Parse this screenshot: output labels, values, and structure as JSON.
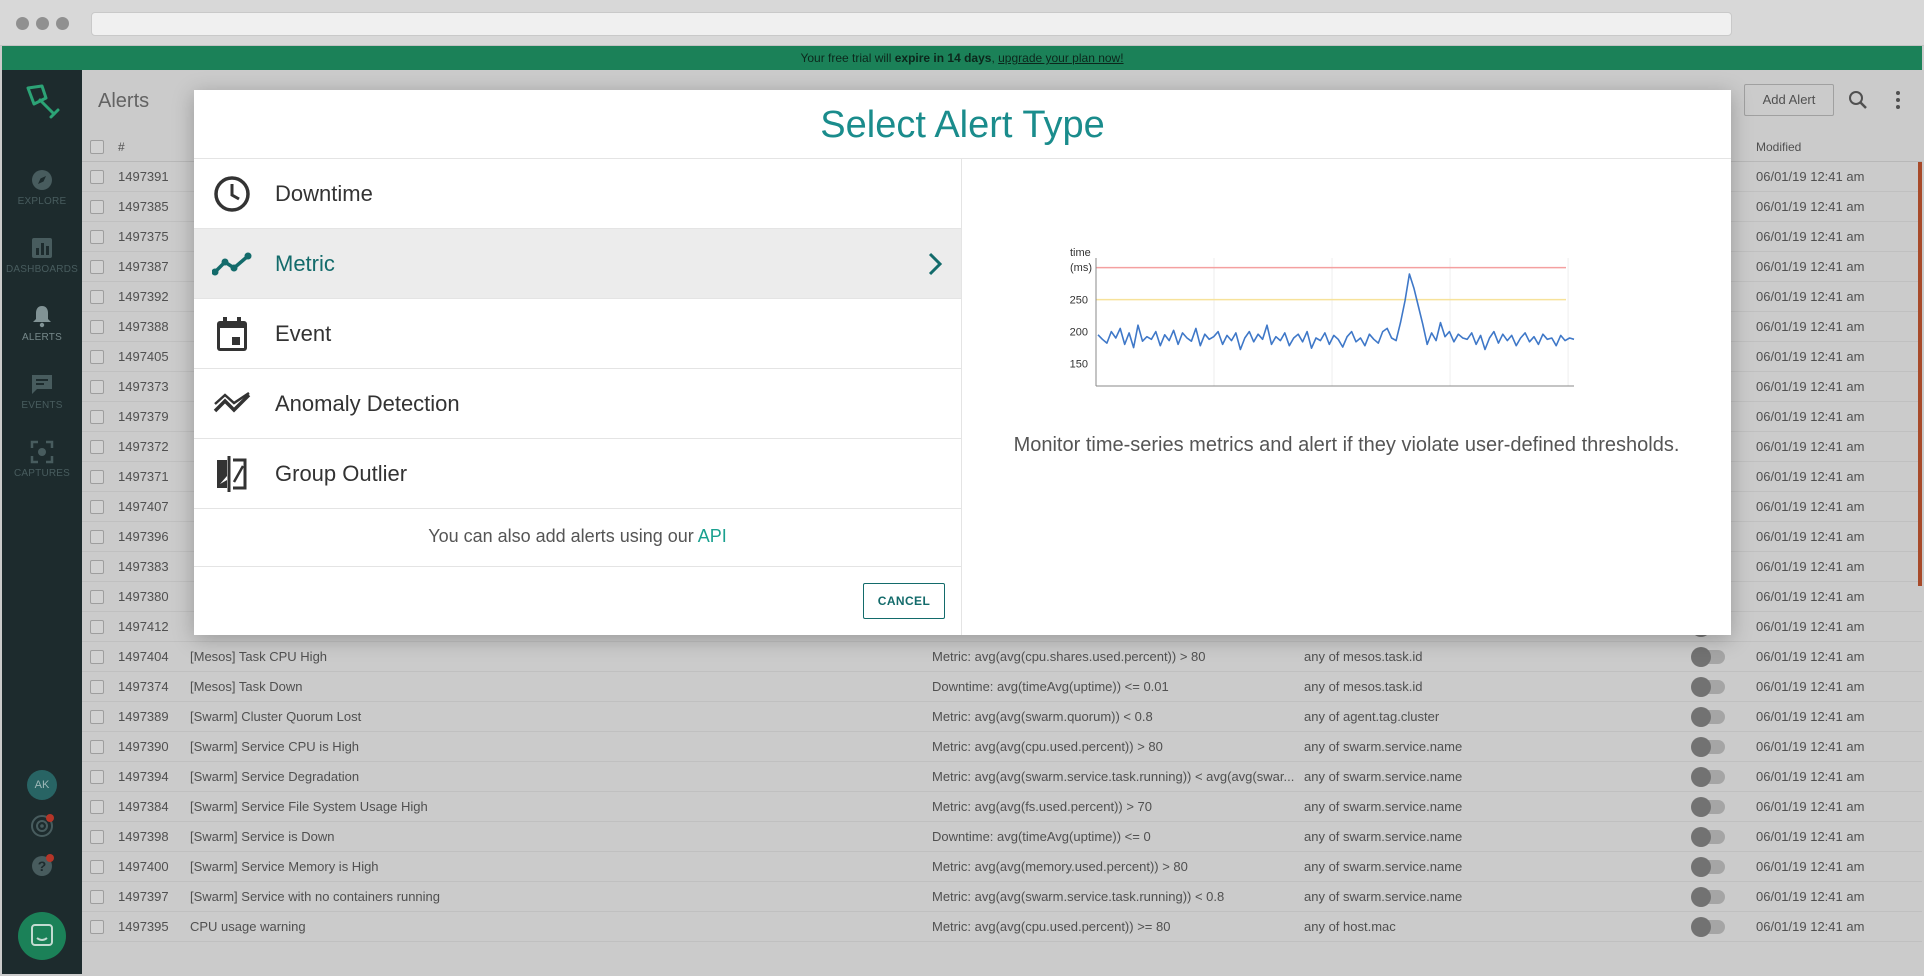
{
  "banner": {
    "prefix": "Your free trial will ",
    "bold": "expire in 14 days",
    "middle": ", ",
    "link": "upgrade your plan now!"
  },
  "sidebar": {
    "items": [
      {
        "label": "EXPLORE",
        "icon": "compass-icon"
      },
      {
        "label": "DASHBOARDS",
        "icon": "bar-chart-icon"
      },
      {
        "label": "ALERTS",
        "icon": "bell-icon"
      },
      {
        "label": "EVENTS",
        "icon": "message-icon"
      },
      {
        "label": "CAPTURES",
        "icon": "capture-icon"
      }
    ],
    "avatar_initials": "AK"
  },
  "page": {
    "title": "Alerts",
    "add_alert_label": "Add Alert"
  },
  "table": {
    "headers": {
      "id": "#",
      "modified": "Modified"
    },
    "rows": [
      {
        "id": "1497391",
        "name": "",
        "condition": "",
        "scope": "",
        "modified": "06/01/19 12:41 am"
      },
      {
        "id": "1497385",
        "name": "",
        "condition": "",
        "scope": "",
        "modified": "06/01/19 12:41 am"
      },
      {
        "id": "1497375",
        "name": "",
        "condition": "",
        "scope": "",
        "modified": "06/01/19 12:41 am"
      },
      {
        "id": "1497387",
        "name": "",
        "condition": "",
        "scope": "",
        "modified": "06/01/19 12:41 am"
      },
      {
        "id": "1497392",
        "name": "",
        "condition": "",
        "scope": "",
        "modified": "06/01/19 12:41 am"
      },
      {
        "id": "1497388",
        "name": "",
        "condition": "",
        "scope": "",
        "modified": "06/01/19 12:41 am"
      },
      {
        "id": "1497405",
        "name": "",
        "condition": "",
        "scope": "",
        "modified": "06/01/19 12:41 am"
      },
      {
        "id": "1497373",
        "name": "",
        "condition": "",
        "scope": "",
        "modified": "06/01/19 12:41 am"
      },
      {
        "id": "1497379",
        "name": "",
        "condition": "",
        "scope": "",
        "modified": "06/01/19 12:41 am"
      },
      {
        "id": "1497372",
        "name": "",
        "condition": "",
        "scope": "",
        "modified": "06/01/19 12:41 am"
      },
      {
        "id": "1497371",
        "name": "",
        "condition": "",
        "scope": "",
        "modified": "06/01/19 12:41 am"
      },
      {
        "id": "1497407",
        "name": "",
        "condition": "",
        "scope": "",
        "modified": "06/01/19 12:41 am"
      },
      {
        "id": "1497396",
        "name": "",
        "condition": "",
        "scope": "",
        "modified": "06/01/19 12:41 am"
      },
      {
        "id": "1497383",
        "name": "",
        "condition": "",
        "scope": "",
        "modified": "06/01/19 12:41 am"
      },
      {
        "id": "1497380",
        "name": "",
        "condition": "",
        "scope": "",
        "modified": "06/01/19 12:41 am"
      },
      {
        "id": "1497412",
        "name": "",
        "condition": "",
        "scope": "",
        "modified": "06/01/19 12:41 am"
      },
      {
        "id": "1497404",
        "name": "[Mesos] Task CPU High",
        "condition": "Metric: avg(avg(cpu.shares.used.percent)) > 80",
        "scope": "any of mesos.task.id",
        "modified": "06/01/19 12:41 am"
      },
      {
        "id": "1497374",
        "name": "[Mesos] Task Down",
        "condition": "Downtime: avg(timeAvg(uptime)) <= 0.01",
        "scope": "any of mesos.task.id",
        "modified": "06/01/19 12:41 am"
      },
      {
        "id": "1497389",
        "name": "[Swarm] Cluster Quorum Lost",
        "condition": "Metric: avg(avg(swarm.quorum)) < 0.8",
        "scope": "any of agent.tag.cluster",
        "modified": "06/01/19 12:41 am"
      },
      {
        "id": "1497390",
        "name": "[Swarm] Service CPU is High",
        "condition": "Metric: avg(avg(cpu.used.percent)) > 80",
        "scope": "any of swarm.service.name",
        "modified": "06/01/19 12:41 am"
      },
      {
        "id": "1497394",
        "name": "[Swarm] Service Degradation",
        "condition": "Metric: avg(avg(swarm.service.task.running)) < avg(avg(swar...",
        "scope": "any of swarm.service.name",
        "modified": "06/01/19 12:41 am"
      },
      {
        "id": "1497384",
        "name": "[Swarm] Service File System Usage High",
        "condition": "Metric: avg(avg(fs.used.percent)) > 70",
        "scope": "any of swarm.service.name",
        "modified": "06/01/19 12:41 am"
      },
      {
        "id": "1497398",
        "name": "[Swarm] Service is Down",
        "condition": "Downtime: avg(timeAvg(uptime)) <= 0",
        "scope": "any of swarm.service.name",
        "modified": "06/01/19 12:41 am"
      },
      {
        "id": "1497400",
        "name": "[Swarm] Service Memory is High",
        "condition": "Metric: avg(avg(memory.used.percent)) > 80",
        "scope": "any of swarm.service.name",
        "modified": "06/01/19 12:41 am"
      },
      {
        "id": "1497397",
        "name": "[Swarm] Service with no containers running",
        "condition": "Metric: avg(avg(swarm.service.task.running)) < 0.8",
        "scope": "any of swarm.service.name",
        "modified": "06/01/19 12:41 am"
      },
      {
        "id": "1497395",
        "name": "CPU usage warning",
        "condition": "Metric: avg(avg(cpu.used.percent)) >= 80",
        "scope": "any of host.mac",
        "modified": "06/01/19 12:41 am"
      }
    ]
  },
  "modal": {
    "title": "Select Alert Type",
    "types": [
      {
        "label": "Downtime",
        "icon": "clock-icon"
      },
      {
        "label": "Metric",
        "icon": "trend-line-icon",
        "active": true
      },
      {
        "label": "Event",
        "icon": "calendar-icon"
      },
      {
        "label": "Anomaly Detection",
        "icon": "anomaly-icon"
      },
      {
        "label": "Group Outlier",
        "icon": "compare-icon"
      }
    ],
    "api_note": "You can also add alerts using our ",
    "api_link": "API",
    "cancel_label": "CANCEL",
    "description": "Monitor time-series metrics and alert if they violate user-defined thresholds.",
    "colors": {
      "accent": "#1a8c8c",
      "active_text": "#136b6b",
      "banner": "#1d8a5e"
    }
  },
  "chart_data": {
    "type": "line",
    "ylabel": "time (ms)",
    "yticks": [
      150,
      200,
      250
    ],
    "ylim": [
      115,
      315
    ],
    "thresholds": [
      {
        "value": 300,
        "color": "#f4a0a0"
      },
      {
        "value": 250,
        "color": "#f7e29a"
      }
    ],
    "series": [
      {
        "color": "#3f78c8",
        "values": [
          195,
          188,
          182,
          200,
          190,
          205,
          180,
          198,
          175,
          210,
          185,
          192,
          188,
          200,
          178,
          195,
          186,
          202,
          180,
          198,
          190,
          185,
          205,
          178,
          196,
          188,
          192,
          200,
          180,
          194,
          186,
          198,
          172,
          190,
          200,
          184,
          196,
          188,
          210,
          180,
          192,
          186,
          198,
          178,
          190,
          196,
          184,
          200,
          174,
          190,
          186,
          198,
          180,
          194,
          188,
          176,
          192,
          200,
          184,
          190,
          178,
          196,
          188,
          182,
          200,
          205,
          190,
          186,
          214,
          248,
          290,
          268,
          240,
          212,
          180,
          198,
          186,
          214,
          192,
          200,
          184,
          196,
          190,
          188,
          198,
          180,
          194,
          172,
          190,
          200,
          182,
          196,
          186,
          194,
          178,
          190,
          198,
          184,
          192,
          180,
          196,
          188,
          190,
          178,
          194,
          186,
          190,
          188
        ]
      }
    ]
  }
}
